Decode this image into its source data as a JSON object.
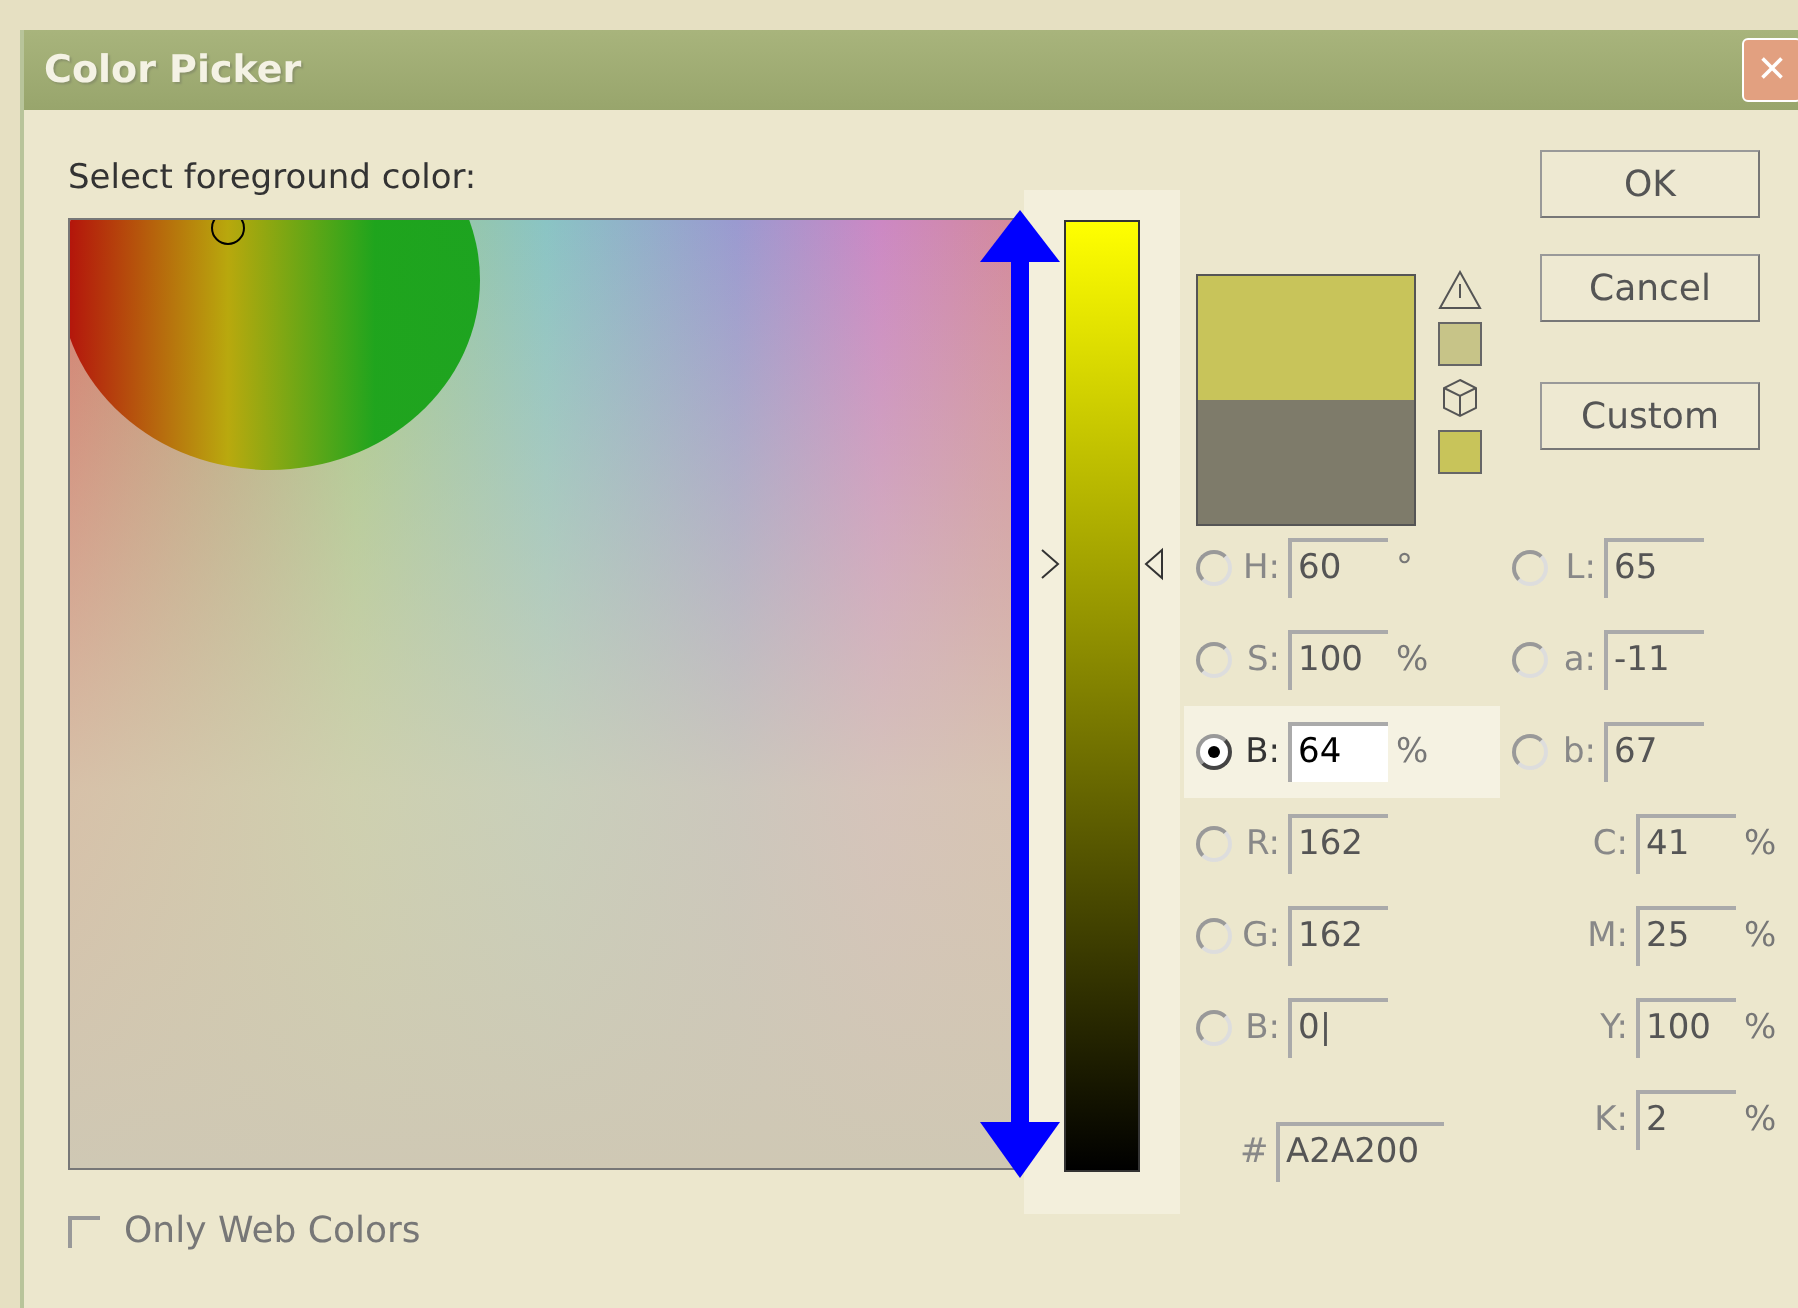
{
  "window": {
    "title": "Color Picker",
    "close": "×"
  },
  "prompt": "Select foreground color:",
  "slider": {
    "level": 0.64
  },
  "buttons": [
    {
      "label": "OK"
    },
    {
      "label": "Cancel"
    },
    {
      "label": "Custom"
    }
  ],
  "left_fields": [
    {
      "kind": "radio",
      "label": "H:",
      "value": "60",
      "unit": "°",
      "selected": false
    },
    {
      "kind": "radio",
      "label": "S:",
      "value": "100",
      "unit": "%",
      "selected": false
    },
    {
      "kind": "radio",
      "label": "B:",
      "value": "64",
      "unit": "%",
      "selected": true
    },
    {
      "kind": "radio",
      "label": "R:",
      "value": "162",
      "selected": false
    },
    {
      "kind": "radio",
      "label": "G:",
      "value": "162",
      "selected": false
    },
    {
      "kind": "radio",
      "label": "B:",
      "value": "0|",
      "selected": false
    },
    {
      "kind": "plain",
      "label": "#",
      "value": "A2A200"
    }
  ],
  "right_fields": [
    {
      "kind": "radio",
      "label": "L:",
      "value": "65",
      "selected": false
    },
    {
      "kind": "radio",
      "label": "a:",
      "value": "-11",
      "selected": false
    },
    {
      "kind": "radio",
      "label": "b:",
      "value": "67",
      "selected": false
    },
    {
      "kind": "plain",
      "label": "C:",
      "value": "41",
      "unit": "%"
    },
    {
      "kind": "plain",
      "label": "M:",
      "value": "25",
      "unit": "%"
    },
    {
      "kind": "plain",
      "label": "Y:",
      "value": "100",
      "unit": "%"
    },
    {
      "kind": "plain",
      "label": "K:",
      "value": "2",
      "unit": "%"
    }
  ],
  "web_colors": {
    "label": "Only Web Colors",
    "checked": false
  }
}
